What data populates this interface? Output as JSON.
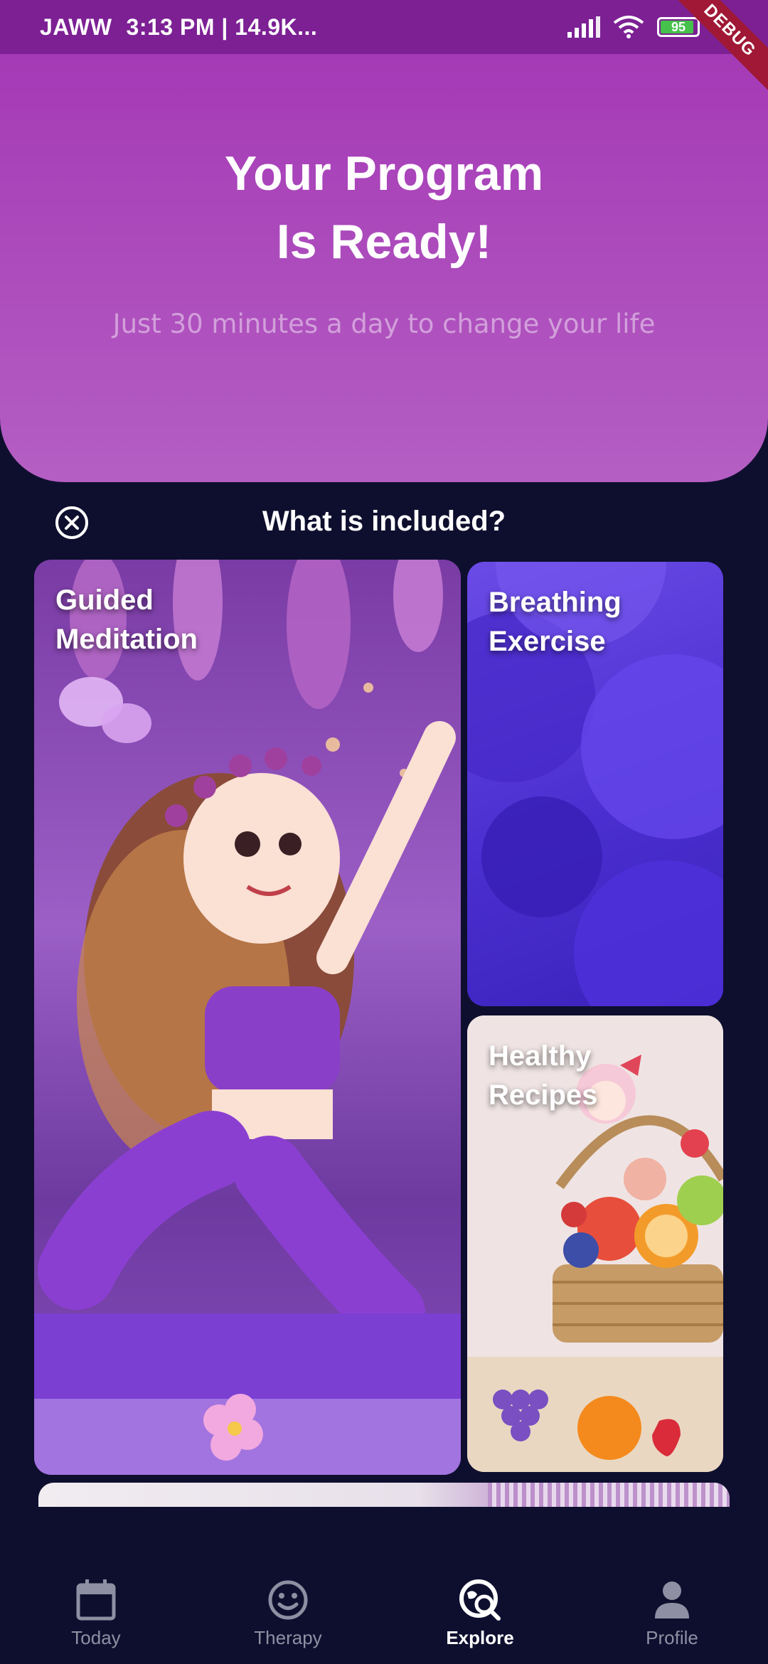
{
  "status_bar": {
    "carrier": "JAWW",
    "time_info": "3:13 PM | 14.9K...",
    "battery": "95",
    "debug_ribbon": "DEBUG"
  },
  "hero": {
    "title_line1": "Your Program",
    "title_line2": "Is Ready!",
    "subtitle": "Just 30 minutes a day to change your life"
  },
  "included": {
    "title": "What is included?"
  },
  "cards": {
    "meditation": "Guided\nMeditation",
    "breathing": "Breathing\nExercise",
    "recipes": "Healthy\nRecipes"
  },
  "bottom_nav": {
    "items": [
      {
        "label": "Today",
        "icon": "calendar-icon"
      },
      {
        "label": "Therapy",
        "icon": "smiley-icon"
      },
      {
        "label": "Explore",
        "icon": "explore-icon",
        "active": true
      },
      {
        "label": "Profile",
        "icon": "person-icon"
      }
    ]
  },
  "colors": {
    "hero_top": "#a53ab6",
    "hero_bottom": "#b45ec3",
    "background": "#0e0f2e",
    "breathing_card": "#4b2fd0",
    "nav_inactive": "#8f8fa3"
  }
}
